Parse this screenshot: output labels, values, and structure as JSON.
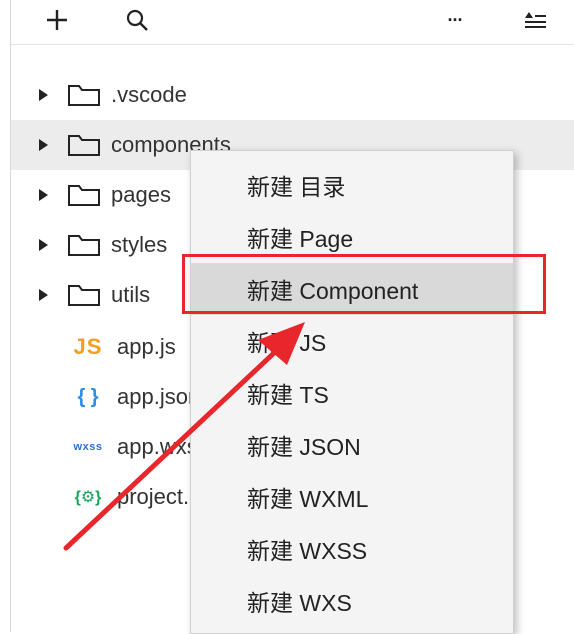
{
  "toolbar": {
    "plus_icon": "plus-icon",
    "search_icon": "search-icon",
    "more_icon": "more-icon",
    "more_glyph": "···",
    "collapse_icon": "collapse-icon"
  },
  "tree": {
    "folders": [
      {
        "name": ".vscode"
      },
      {
        "name": "components"
      },
      {
        "name": "pages"
      },
      {
        "name": "styles"
      },
      {
        "name": "utils"
      }
    ],
    "files": [
      {
        "icon_text": "JS",
        "name": "app.js"
      },
      {
        "icon_text": "{ }",
        "name": "app.json"
      },
      {
        "icon_text": "wxss",
        "name": "app.wxss"
      },
      {
        "icon_text": "{⚙}",
        "name": "project.config.json"
      }
    ]
  },
  "context_menu": {
    "items": [
      {
        "label": "新建 目录"
      },
      {
        "label": "新建 Page"
      },
      {
        "label": "新建 Component"
      },
      {
        "label": "新建 JS"
      },
      {
        "label": "新建 TS"
      },
      {
        "label": "新建 JSON"
      },
      {
        "label": "新建 WXML"
      },
      {
        "label": "新建 WXSS"
      },
      {
        "label": "新建 WXS"
      }
    ],
    "highlighted_index": 2
  },
  "colors": {
    "annotation": "#e8262b",
    "js_icon": "#f0a020",
    "json_icon": "#2b8de8",
    "wxss_icon": "#2c6fd6",
    "project_icon": "#18a35a",
    "menu_bg": "#f4f4f4",
    "menu_active_bg": "#d9d9d9",
    "row_highlight_bg": "#ececec"
  }
}
